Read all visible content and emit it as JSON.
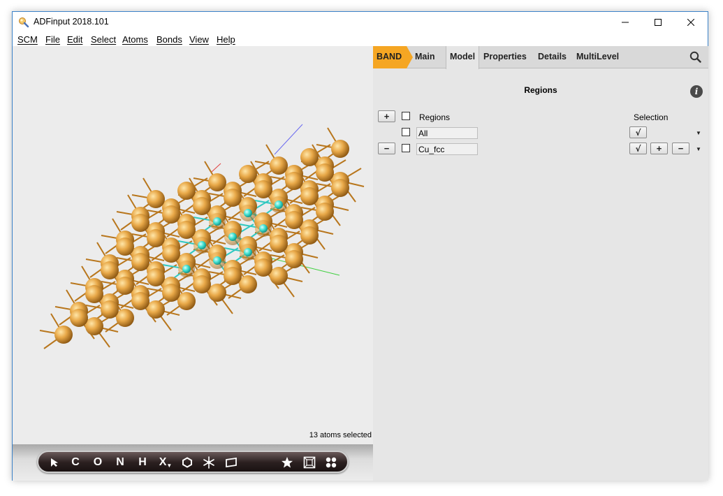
{
  "window": {
    "title": "ADFinput 2018.101"
  },
  "menu": [
    "SCM",
    "File",
    "Edit",
    "Select",
    "Atoms",
    "Bonds",
    "View",
    "Help"
  ],
  "viewport": {
    "selection_status": "13 atoms selected"
  },
  "toolbar": {
    "tools": [
      {
        "name": "select-arrow-tool",
        "label": ""
      },
      {
        "name": "carbon-tool",
        "label": "C"
      },
      {
        "name": "oxygen-tool",
        "label": "O"
      },
      {
        "name": "nitrogen-tool",
        "label": "N"
      },
      {
        "name": "hydrogen-tool",
        "label": "H"
      },
      {
        "name": "other-element-tool",
        "label": "X"
      },
      {
        "name": "ring-tool",
        "label": ""
      },
      {
        "name": "snowflake-tool",
        "label": ""
      },
      {
        "name": "plane-tool",
        "label": ""
      },
      {
        "name": "favorite-tool",
        "label": ""
      },
      {
        "name": "box-tool",
        "label": ""
      },
      {
        "name": "molecule-tool",
        "label": ""
      }
    ]
  },
  "panel": {
    "program_tab": "BAND",
    "tabs": [
      "Main",
      "Model",
      "Properties",
      "Details",
      "MultiLevel"
    ],
    "active_tab": "Model",
    "title": "Regions",
    "regions_header": "Regions",
    "selection_header": "Selection",
    "regions": [
      {
        "name": "All",
        "checked": false
      },
      {
        "name": "Cu_fcc",
        "checked": false
      }
    ],
    "buttons": {
      "add": "+",
      "remove": "−",
      "select": "√",
      "add_selection": "+",
      "remove_selection": "−",
      "dropdown": "▼"
    },
    "colors": {
      "program_tab": "#f5a623",
      "atom_copper": "#e0a040",
      "atom_selected": "#40e0d0"
    }
  }
}
